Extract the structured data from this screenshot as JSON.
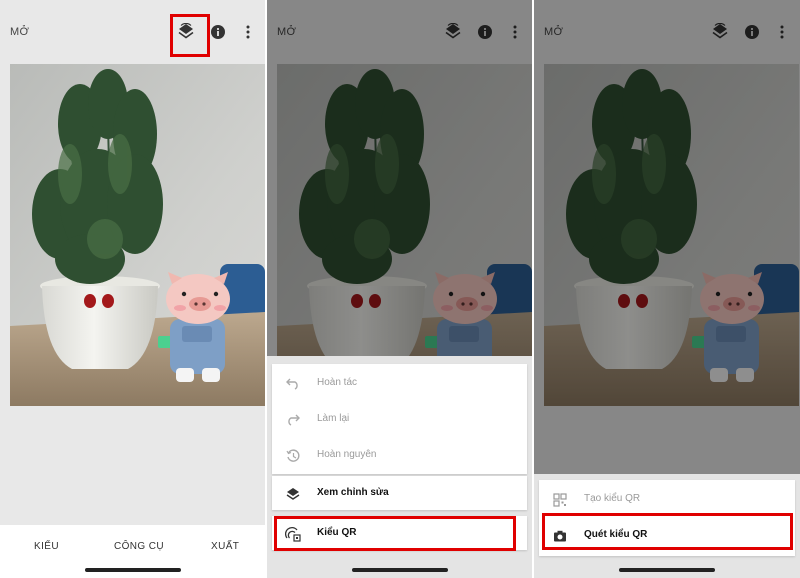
{
  "topbar": {
    "open_label": "MỞ"
  },
  "bottom_nav": {
    "styles": "KIỂU",
    "tools": "CÔNG CỤ",
    "export": "XUẤT"
  },
  "menu_edit": {
    "undo": "Hoàn tác",
    "redo": "Làm lại",
    "revert": "Hoàn nguyên",
    "view_edits": "Xem chỉnh sửa",
    "qr_style": "Kiểu QR"
  },
  "menu_qr": {
    "create_qr": "Tạo kiểu QR",
    "scan_qr": "Quét kiểu QR"
  },
  "highlight_color": "#e00000",
  "icons": [
    "layers-icon",
    "info-icon",
    "more-vert-icon",
    "undo-icon",
    "redo-icon",
    "history-icon",
    "layers-icon",
    "qr-style-icon",
    "qr-code-icon",
    "camera-icon"
  ]
}
